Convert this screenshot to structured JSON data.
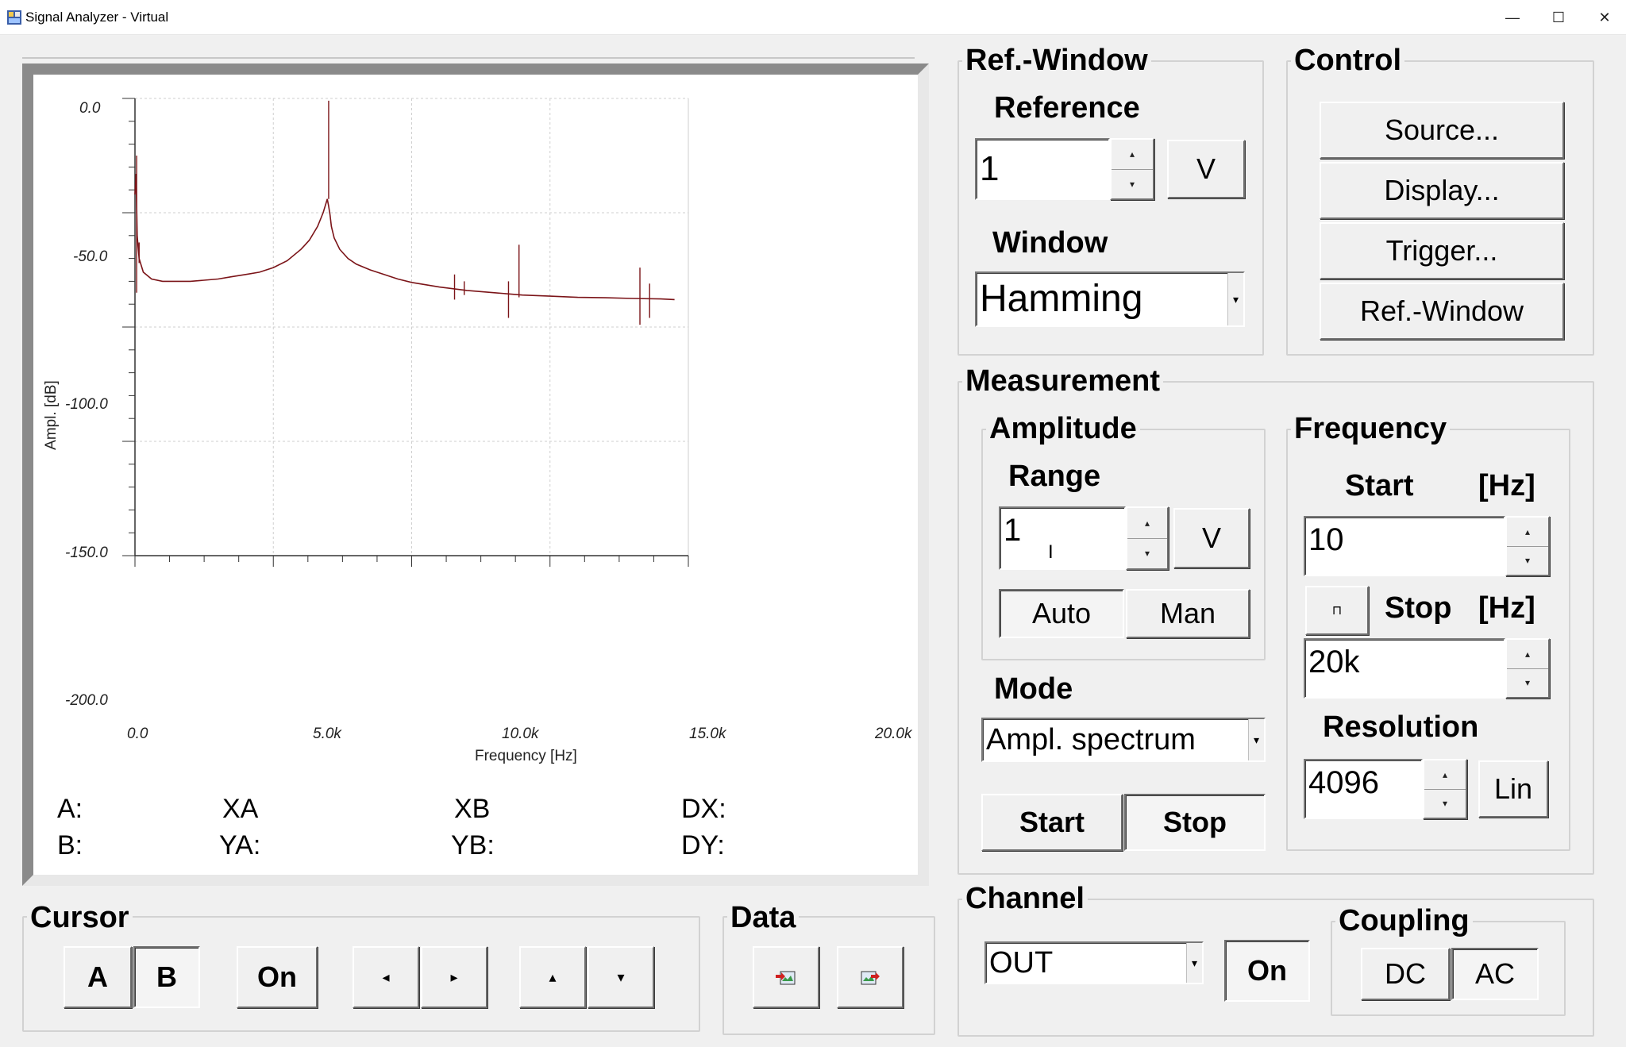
{
  "window": {
    "title": "Signal Analyzer - Virtual",
    "minimize": "—",
    "maximize": "☐",
    "close": "✕"
  },
  "chart_data": {
    "type": "line",
    "title": "",
    "xlabel": "Frequency [Hz]",
    "ylabel": "Ampl. [dB]",
    "xlim": [
      0,
      20000
    ],
    "ylim": [
      -200,
      0
    ],
    "x_ticks": [
      "0.0",
      "5.0k",
      "10.0k",
      "15.0k",
      "20.0k"
    ],
    "y_ticks": [
      "0.0",
      "-50.0",
      "-100.0",
      "-150.0",
      "-200.0"
    ],
    "grid": true,
    "color": "#7b1418",
    "series": [
      {
        "x": [
          0,
          40,
          80,
          150,
          300,
          600,
          1000,
          1500,
          2000,
          2500,
          3000,
          3500,
          4000,
          4500,
          5000,
          5500,
          6000,
          6300,
          6600,
          6800,
          6900,
          6950,
          7000,
          7050,
          7100,
          7200,
          7400,
          7700,
          8000,
          8500,
          9000,
          9500,
          10000,
          11000,
          12000,
          13000,
          14000,
          15000,
          16000,
          17000,
          18000,
          19000,
          19500
        ],
        "y": [
          -42,
          -33,
          -60,
          -70,
          -76,
          -79,
          -80,
          -80,
          -80,
          -79.5,
          -79,
          -78,
          -77,
          -76,
          -74,
          -71,
          -66,
          -62,
          -56,
          -50,
          -46,
          -44,
          -47,
          -51,
          -56,
          -61,
          -66,
          -70,
          -72.5,
          -75,
          -77,
          -79,
          -80.5,
          -82.5,
          -84,
          -85,
          -86,
          -86.5,
          -87,
          -87.2,
          -87.5,
          -87.7,
          -88
        ]
      }
    ],
    "spikes": [
      {
        "x": 60,
        "top": -25,
        "bottom": -85
      },
      {
        "x": 150,
        "top": -63,
        "bottom": -72
      },
      {
        "x": 7000,
        "top": -1,
        "bottom": -44
      },
      {
        "x": 11550,
        "top": -77,
        "bottom": -88
      },
      {
        "x": 11900,
        "top": -80,
        "bottom": -86
      },
      {
        "x": 13500,
        "top": -80,
        "bottom": -96
      },
      {
        "x": 13880,
        "top": -64,
        "bottom": -87
      },
      {
        "x": 18250,
        "top": -74,
        "bottom": -99
      },
      {
        "x": 18600,
        "top": -81,
        "bottom": -96
      }
    ]
  },
  "cursor_readout": {
    "a": "A:",
    "b": "B:",
    "xa": "XA",
    "ya": "YA:",
    "xb": "XB",
    "yb": "YB:",
    "dx": "DX:",
    "dy": "DY:"
  },
  "cursor_panel": {
    "title": "Cursor",
    "a": "A",
    "b": "B",
    "on": "On",
    "left": "◂",
    "right": "▸",
    "up": "▴",
    "down": "▾"
  },
  "data_panel": {
    "title": "Data"
  },
  "ref_window": {
    "title": "Ref.-Window",
    "reference_label": "Reference",
    "reference_value": "1",
    "reference_unit": "V",
    "window_label": "Window",
    "window_value": "Hamming"
  },
  "control": {
    "title": "Control",
    "source": "Source...",
    "display": "Display...",
    "trigger": "Trigger...",
    "refwindow": "Ref.-Window"
  },
  "measurement": {
    "title": "Measurement",
    "amplitude": {
      "title": "Amplitude",
      "range_label": "Range",
      "range_value": "1",
      "range_unit": "V",
      "auto": "Auto",
      "man": "Man"
    },
    "mode_label": "Mode",
    "mode_value": "Ampl. spectrum",
    "start": "Start",
    "stop": "Stop",
    "frequency": {
      "title": "Frequency",
      "start_label": "Start",
      "start_unit": "[Hz]",
      "start_value": "10",
      "stop_label": "Stop",
      "stop_unit": "[Hz]",
      "stop_value": "20k",
      "resolution_label": "Resolution",
      "resolution_value": "4096",
      "scale": "Lin"
    }
  },
  "channel": {
    "title": "Channel",
    "value": "OUT",
    "on": "On",
    "coupling_title": "Coupling",
    "dc": "DC",
    "ac": "AC"
  }
}
